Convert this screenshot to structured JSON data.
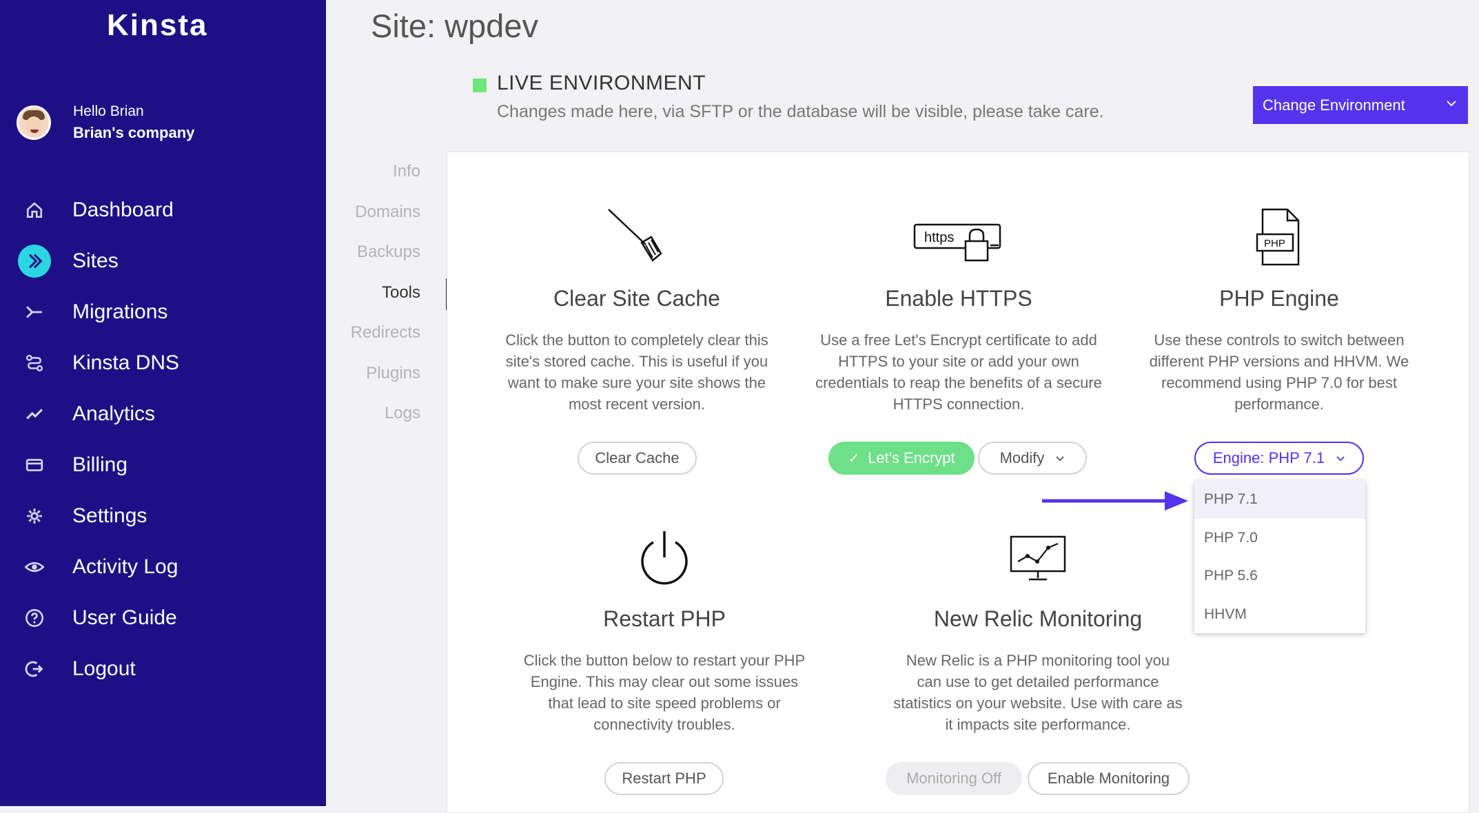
{
  "brand": {
    "logo_text": "Kinsta"
  },
  "user": {
    "greeting": "Hello Brian",
    "company": "Brian's company"
  },
  "sidebar": {
    "items": [
      {
        "label": "Dashboard",
        "icon": "home-icon"
      },
      {
        "label": "Sites",
        "icon": "sites-icon",
        "active": true
      },
      {
        "label": "Migrations",
        "icon": "migrations-icon"
      },
      {
        "label": "Kinsta DNS",
        "icon": "dns-icon"
      },
      {
        "label": "Analytics",
        "icon": "analytics-icon"
      },
      {
        "label": "Billing",
        "icon": "billing-icon"
      },
      {
        "label": "Settings",
        "icon": "gear-icon"
      },
      {
        "label": "Activity Log",
        "icon": "eye-icon"
      },
      {
        "label": "User Guide",
        "icon": "help-icon"
      },
      {
        "label": "Logout",
        "icon": "logout-icon"
      }
    ]
  },
  "header": {
    "site_title": "Site: wpdev",
    "environment_label": "LIVE ENVIRONMENT",
    "environment_warning": "Changes made here, via SFTP or the database will be visible, please take care.",
    "environment_color": "#6ee87a",
    "change_env_label": "Change Environment"
  },
  "subnav": {
    "items": [
      "Info",
      "Domains",
      "Backups",
      "Tools",
      "Redirects",
      "Plugins",
      "Logs"
    ],
    "active": "Tools"
  },
  "tools": {
    "clear_cache": {
      "title": "Clear Site Cache",
      "description": "Click the button to completely clear this site's stored cache. This is useful if you want to make sure your site shows the most recent version.",
      "button": "Clear Cache"
    },
    "https": {
      "title": "Enable HTTPS",
      "icon_text": "https",
      "description": "Use a free Let's Encrypt certificate to add HTTPS to your site or add your own credentials to reap the benefits of a secure HTTPS connection.",
      "button_primary": "Let's Encrypt",
      "button_secondary": "Modify"
    },
    "php": {
      "title": "PHP Engine",
      "icon_text": "PHP",
      "description": "Use these controls to switch between different PHP versions and HHVM. We recommend using PHP 7.0 for best performance.",
      "button": "Engine: PHP 7.1",
      "options": [
        "PHP 7.1",
        "PHP 7.0",
        "PHP 5.6",
        "HHVM"
      ],
      "selected": "PHP 7.1"
    },
    "restart_php": {
      "title": "Restart PHP",
      "description": "Click the button below to restart your PHP Engine. This may clear out some issues that lead to site speed problems or connectivity troubles.",
      "button": "Restart PHP"
    },
    "new_relic": {
      "title": "New Relic Monitoring",
      "description": "New Relic is a PHP monitoring tool you can use to get detailed performance statistics on your website. Use with care as it impacts site performance.",
      "button_off": "Monitoring Off",
      "button_enable": "Enable Monitoring"
    }
  },
  "colors": {
    "sidebar_bg": "#1f0f86",
    "accent": "#5333ed",
    "active_icon": "#2bd6e0",
    "success": "#6ee087"
  }
}
